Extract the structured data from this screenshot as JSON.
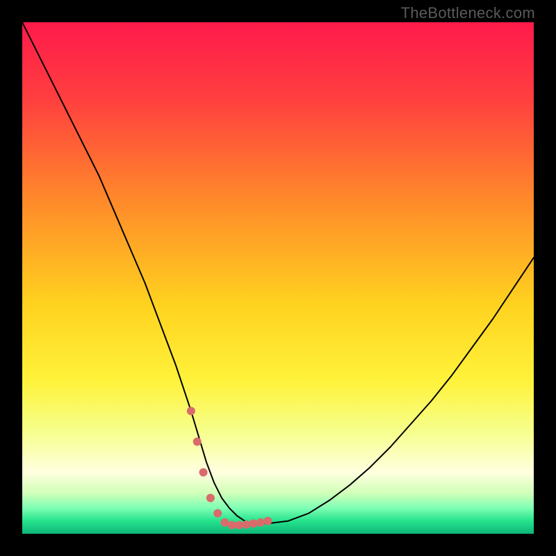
{
  "watermark": "TheBottleneck.com",
  "chart_data": {
    "type": "line",
    "title": "",
    "xlabel": "",
    "ylabel": "",
    "xlim": [
      0,
      100
    ],
    "ylim": [
      0,
      100
    ],
    "grid": false,
    "legend": false,
    "gradient_stops": [
      {
        "offset": 0.0,
        "color": "#ff1a4b"
      },
      {
        "offset": 0.15,
        "color": "#ff3f3f"
      },
      {
        "offset": 0.35,
        "color": "#ff8a2a"
      },
      {
        "offset": 0.55,
        "color": "#ffd21f"
      },
      {
        "offset": 0.7,
        "color": "#fff23a"
      },
      {
        "offset": 0.8,
        "color": "#f6ff8c"
      },
      {
        "offset": 0.88,
        "color": "#ffffe0"
      },
      {
        "offset": 0.92,
        "color": "#d2ffb8"
      },
      {
        "offset": 0.95,
        "color": "#7dffb4"
      },
      {
        "offset": 0.975,
        "color": "#26e28c"
      },
      {
        "offset": 1.0,
        "color": "#0cb67a"
      }
    ],
    "series": [
      {
        "name": "bottleneck-curve",
        "color": "#000000",
        "stroke_width": 2,
        "x": [
          0,
          3,
          6,
          9,
          12,
          15,
          18,
          21,
          24,
          27,
          30,
          33,
          34.5,
          36,
          37.5,
          39,
          40.5,
          42,
          43.5,
          45,
          48,
          52,
          56,
          60,
          64,
          68,
          72,
          76,
          80,
          84,
          88,
          92,
          96,
          100
        ],
        "y": [
          100,
          94,
          88,
          82,
          76,
          70,
          63,
          56,
          49,
          41,
          33,
          24,
          19,
          14,
          10,
          7,
          5,
          3.5,
          2.5,
          2.0,
          2.0,
          2.5,
          4.0,
          6.5,
          9.5,
          13,
          17,
          21.5,
          26,
          31,
          36.5,
          42,
          48,
          54
        ]
      }
    ],
    "markers": {
      "name": "highlight-dots",
      "color": "#d96b6b",
      "radius": 6,
      "x": [
        33.0,
        34.2,
        35.4,
        36.8,
        38.2,
        39.6,
        41.0,
        42.4,
        43.8,
        45.2,
        46.6,
        48.0
      ],
      "y": [
        24.0,
        18.0,
        12.0,
        7.0,
        4.0,
        2.2,
        1.7,
        1.7,
        1.8,
        2.0,
        2.2,
        2.5
      ]
    }
  }
}
